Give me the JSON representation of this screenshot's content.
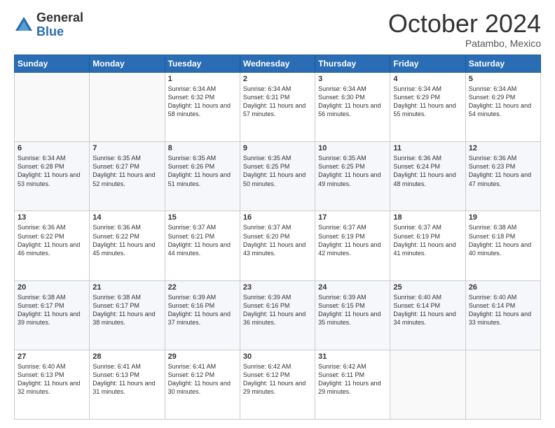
{
  "header": {
    "logo": {
      "general": "General",
      "blue": "Blue"
    },
    "title": "October 2024",
    "location": "Patambo, Mexico"
  },
  "calendar": {
    "days_of_week": [
      "Sunday",
      "Monday",
      "Tuesday",
      "Wednesday",
      "Thursday",
      "Friday",
      "Saturday"
    ],
    "weeks": [
      [
        {
          "day": "",
          "info": ""
        },
        {
          "day": "",
          "info": ""
        },
        {
          "day": "1",
          "info": "Sunrise: 6:34 AM\nSunset: 6:32 PM\nDaylight: 11 hours and 58 minutes."
        },
        {
          "day": "2",
          "info": "Sunrise: 6:34 AM\nSunset: 6:31 PM\nDaylight: 11 hours and 57 minutes."
        },
        {
          "day": "3",
          "info": "Sunrise: 6:34 AM\nSunset: 6:30 PM\nDaylight: 11 hours and 56 minutes."
        },
        {
          "day": "4",
          "info": "Sunrise: 6:34 AM\nSunset: 6:29 PM\nDaylight: 11 hours and 55 minutes."
        },
        {
          "day": "5",
          "info": "Sunrise: 6:34 AM\nSunset: 6:29 PM\nDaylight: 11 hours and 54 minutes."
        }
      ],
      [
        {
          "day": "6",
          "info": "Sunrise: 6:34 AM\nSunset: 6:28 PM\nDaylight: 11 hours and 53 minutes."
        },
        {
          "day": "7",
          "info": "Sunrise: 6:35 AM\nSunset: 6:27 PM\nDaylight: 11 hours and 52 minutes."
        },
        {
          "day": "8",
          "info": "Sunrise: 6:35 AM\nSunset: 6:26 PM\nDaylight: 11 hours and 51 minutes."
        },
        {
          "day": "9",
          "info": "Sunrise: 6:35 AM\nSunset: 6:25 PM\nDaylight: 11 hours and 50 minutes."
        },
        {
          "day": "10",
          "info": "Sunrise: 6:35 AM\nSunset: 6:25 PM\nDaylight: 11 hours and 49 minutes."
        },
        {
          "day": "11",
          "info": "Sunrise: 6:36 AM\nSunset: 6:24 PM\nDaylight: 11 hours and 48 minutes."
        },
        {
          "day": "12",
          "info": "Sunrise: 6:36 AM\nSunset: 6:23 PM\nDaylight: 11 hours and 47 minutes."
        }
      ],
      [
        {
          "day": "13",
          "info": "Sunrise: 6:36 AM\nSunset: 6:22 PM\nDaylight: 11 hours and 46 minutes."
        },
        {
          "day": "14",
          "info": "Sunrise: 6:36 AM\nSunset: 6:22 PM\nDaylight: 11 hours and 45 minutes."
        },
        {
          "day": "15",
          "info": "Sunrise: 6:37 AM\nSunset: 6:21 PM\nDaylight: 11 hours and 44 minutes."
        },
        {
          "day": "16",
          "info": "Sunrise: 6:37 AM\nSunset: 6:20 PM\nDaylight: 11 hours and 43 minutes."
        },
        {
          "day": "17",
          "info": "Sunrise: 6:37 AM\nSunset: 6:19 PM\nDaylight: 11 hours and 42 minutes."
        },
        {
          "day": "18",
          "info": "Sunrise: 6:37 AM\nSunset: 6:19 PM\nDaylight: 11 hours and 41 minutes."
        },
        {
          "day": "19",
          "info": "Sunrise: 6:38 AM\nSunset: 6:18 PM\nDaylight: 11 hours and 40 minutes."
        }
      ],
      [
        {
          "day": "20",
          "info": "Sunrise: 6:38 AM\nSunset: 6:17 PM\nDaylight: 11 hours and 39 minutes."
        },
        {
          "day": "21",
          "info": "Sunrise: 6:38 AM\nSunset: 6:17 PM\nDaylight: 11 hours and 38 minutes."
        },
        {
          "day": "22",
          "info": "Sunrise: 6:39 AM\nSunset: 6:16 PM\nDaylight: 11 hours and 37 minutes."
        },
        {
          "day": "23",
          "info": "Sunrise: 6:39 AM\nSunset: 6:16 PM\nDaylight: 11 hours and 36 minutes."
        },
        {
          "day": "24",
          "info": "Sunrise: 6:39 AM\nSunset: 6:15 PM\nDaylight: 11 hours and 35 minutes."
        },
        {
          "day": "25",
          "info": "Sunrise: 6:40 AM\nSunset: 6:14 PM\nDaylight: 11 hours and 34 minutes."
        },
        {
          "day": "26",
          "info": "Sunrise: 6:40 AM\nSunset: 6:14 PM\nDaylight: 11 hours and 33 minutes."
        }
      ],
      [
        {
          "day": "27",
          "info": "Sunrise: 6:40 AM\nSunset: 6:13 PM\nDaylight: 11 hours and 32 minutes."
        },
        {
          "day": "28",
          "info": "Sunrise: 6:41 AM\nSunset: 6:13 PM\nDaylight: 11 hours and 31 minutes."
        },
        {
          "day": "29",
          "info": "Sunrise: 6:41 AM\nSunset: 6:12 PM\nDaylight: 11 hours and 30 minutes."
        },
        {
          "day": "30",
          "info": "Sunrise: 6:42 AM\nSunset: 6:12 PM\nDaylight: 11 hours and 29 minutes."
        },
        {
          "day": "31",
          "info": "Sunrise: 6:42 AM\nSunset: 6:11 PM\nDaylight: 11 hours and 29 minutes."
        },
        {
          "day": "",
          "info": ""
        },
        {
          "day": "",
          "info": ""
        }
      ]
    ]
  }
}
